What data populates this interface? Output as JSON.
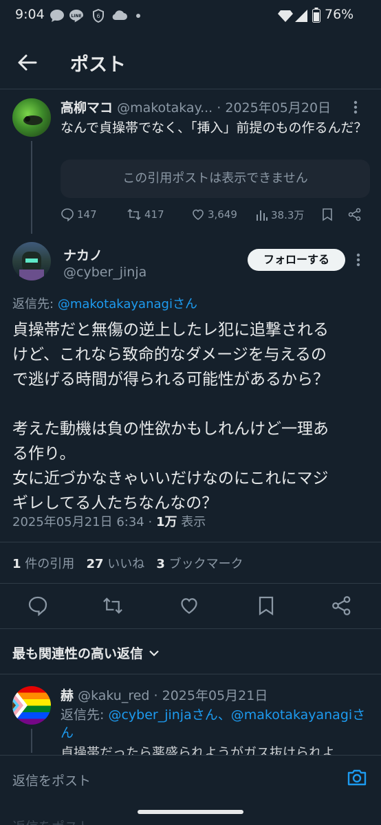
{
  "status_bar": {
    "time": "9:04",
    "battery": "76%"
  },
  "header": {
    "title": "ポスト"
  },
  "quoted": {
    "name": "高柳マコ",
    "handle": "@makotakay...",
    "date": "· 2025年05月20日",
    "text": "なんで貞操帯でなく、「挿入」前提のもの作るんだ？",
    "card": "この引用ポストは表示できません",
    "replies": "147",
    "reposts": "417",
    "likes": "3,649",
    "views": "38.3万"
  },
  "post": {
    "name": "ナカノ",
    "handle": "@cyber_jinja",
    "follow": "フォローする",
    "reply_prefix": "返信先:",
    "reply_to": "@makotakayanagiさん",
    "lines": [
      "貞操帯だと無傷の逆上したレ犯に追撃される",
      "けど、これなら致命的なダメージを与えるの",
      "で逃げる時間が得られる可能性があるから？",
      "",
      "考えた動機は負の性欲かもしれんけど一理あ",
      "る作り。",
      "女に近づかなきゃいいだけなのにこれにマジ",
      "ギレしてる人たちなんなの？"
    ],
    "datetime": "2025年05月21日 6:34 · ",
    "views_count": "1万",
    "views_label": " 表示",
    "quotes_count": "1",
    "quotes_label": " 件の引用",
    "likes_count": "27",
    "likes_label": " いいね",
    "bookmarks_count": "3",
    "bookmarks_label": " ブックマーク"
  },
  "sort": {
    "label": "最も関連性の高い返信"
  },
  "reply": {
    "name": "赫",
    "handle": "@kaku_red",
    "date": "· 2025年05月21日",
    "reply_prefix": "返信先:",
    "reply_to_1": "@cyber_jinjaさん",
    "sep": "、",
    "reply_to_2": "@makotakayanagiさん",
    "text": "貞操帯だったら薬盛られようがガス抜けられよ"
  },
  "composer": {
    "placeholder": "返信をポスト",
    "under": "返信をポスト"
  },
  "colors": {
    "bg": "#15202b",
    "accent": "#1d9bf0",
    "muted": "#8b98a5"
  }
}
